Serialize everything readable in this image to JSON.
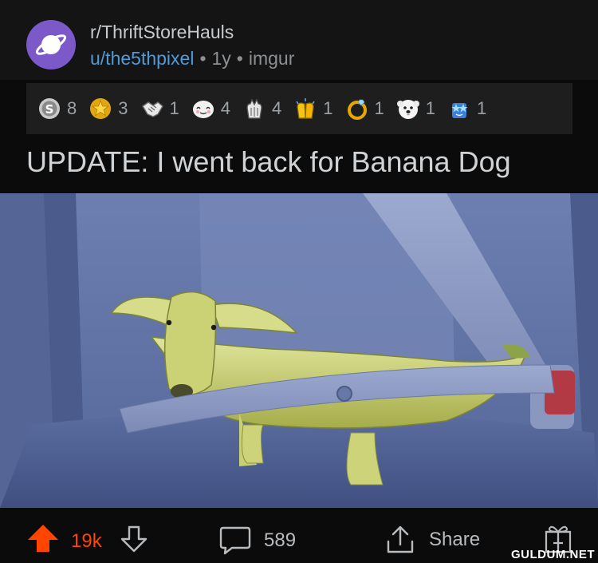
{
  "post": {
    "subreddit": "r/ThriftStoreHauls",
    "author": "u/the5thpixel",
    "age": "1y",
    "source": "imgur",
    "separator": "•",
    "title": "UPDATE: I went back for Banana Dog"
  },
  "awards": [
    {
      "icon": "silver-award-icon",
      "count": "8"
    },
    {
      "icon": "gold-star-award-icon",
      "count": "3"
    },
    {
      "icon": "handshake-award-icon",
      "count": "1"
    },
    {
      "icon": "wholesome-award-icon",
      "count": "4"
    },
    {
      "icon": "applause-award-icon",
      "count": "4"
    },
    {
      "icon": "clapping-hands-award-icon",
      "count": "1"
    },
    {
      "icon": "ring-award-icon",
      "count": "1"
    },
    {
      "icon": "dog-face-award-icon",
      "count": "1"
    },
    {
      "icon": "starstruck-award-icon",
      "count": "1"
    }
  ],
  "actions": {
    "votes": "19k",
    "comments": "589",
    "share": "Share"
  },
  "watermark": "GULDUM.NET",
  "colors": {
    "upvote": "#ff4500",
    "avatar": "#7b59c8",
    "author_link": "#4f9bd9"
  }
}
